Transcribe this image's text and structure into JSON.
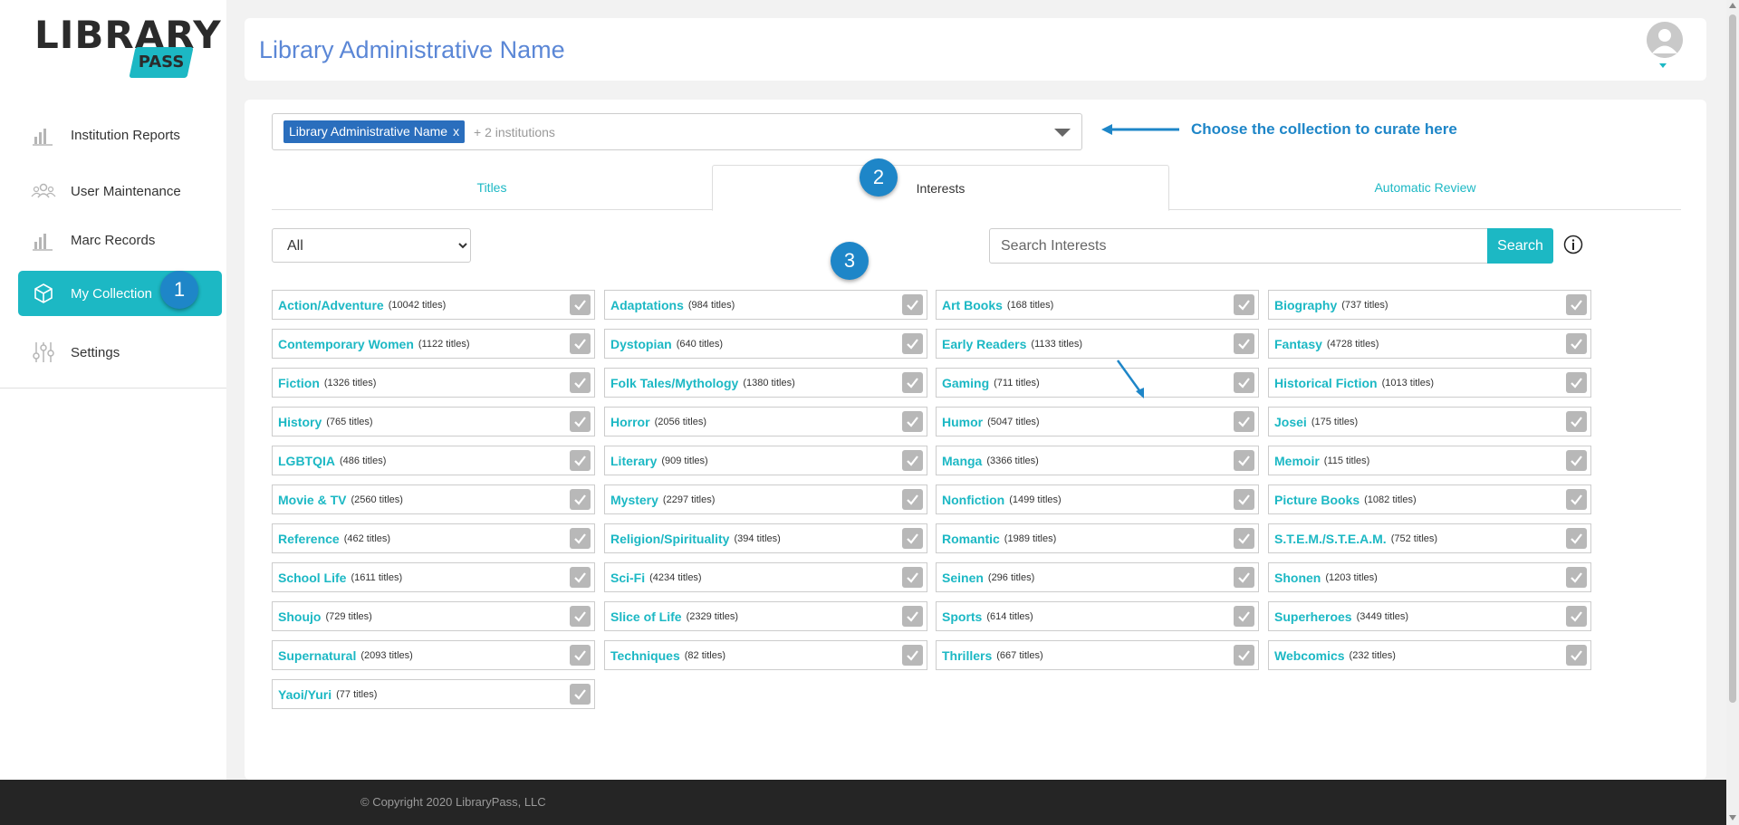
{
  "brand": {
    "logo_top": "LIBRARY",
    "logo_sub": "PASS"
  },
  "sidebar": {
    "items": [
      {
        "label": "Institution Reports",
        "icon": "bar-chart-icon"
      },
      {
        "label": "User Maintenance",
        "icon": "users-icon"
      },
      {
        "label": "Marc Records",
        "icon": "bar-chart-icon"
      },
      {
        "label": "My Collection",
        "icon": "box-icon",
        "active": true
      },
      {
        "label": "Settings",
        "icon": "sliders-icon"
      }
    ]
  },
  "header": {
    "title": "Library Administrative Name"
  },
  "collection_select": {
    "chip_label": "Library Administrative Name",
    "chip_remove": "x",
    "more": "+ 2 institutions",
    "hint": "Choose the collection to curate here"
  },
  "tabs": [
    {
      "label": "Titles"
    },
    {
      "label": "Interests",
      "active": true
    },
    {
      "label": "Automatic Review"
    }
  ],
  "filter": {
    "selected": "All"
  },
  "search": {
    "placeholder": "Search Interests",
    "button": "Search"
  },
  "annotations": {
    "one": "1",
    "two": "2",
    "three": "3"
  },
  "interests": [
    {
      "name": "Action/Adventure",
      "count": "(10042 titles)"
    },
    {
      "name": "Adaptations",
      "count": "(984 titles)"
    },
    {
      "name": "Art Books",
      "count": "(168 titles)"
    },
    {
      "name": "Biography",
      "count": "(737 titles)"
    },
    {
      "name": "Contemporary Women",
      "count": "(1122 titles)"
    },
    {
      "name": "Dystopian",
      "count": "(640 titles)"
    },
    {
      "name": "Early Readers",
      "count": "(1133 titles)"
    },
    {
      "name": "Fantasy",
      "count": "(4728 titles)"
    },
    {
      "name": "Fiction",
      "count": "(1326 titles)"
    },
    {
      "name": "Folk Tales/Mythology",
      "count": "(1380 titles)"
    },
    {
      "name": "Gaming",
      "count": "(711 titles)"
    },
    {
      "name": "Historical Fiction",
      "count": "(1013 titles)"
    },
    {
      "name": "History",
      "count": "(765 titles)"
    },
    {
      "name": "Horror",
      "count": "(2056 titles)"
    },
    {
      "name": "Humor",
      "count": "(5047 titles)"
    },
    {
      "name": "Josei",
      "count": "(175 titles)"
    },
    {
      "name": "LGBTQIA",
      "count": "(486 titles)"
    },
    {
      "name": "Literary",
      "count": "(909 titles)"
    },
    {
      "name": "Manga",
      "count": "(3366 titles)"
    },
    {
      "name": "Memoir",
      "count": "(115 titles)"
    },
    {
      "name": "Movie & TV",
      "count": "(2560 titles)"
    },
    {
      "name": "Mystery",
      "count": "(2297 titles)"
    },
    {
      "name": "Nonfiction",
      "count": "(1499 titles)"
    },
    {
      "name": "Picture Books",
      "count": "(1082 titles)"
    },
    {
      "name": "Reference",
      "count": "(462 titles)"
    },
    {
      "name": "Religion/Spirituality",
      "count": "(394 titles)"
    },
    {
      "name": "Romantic",
      "count": "(1989 titles)"
    },
    {
      "name": "S.T.E.M./S.T.E.A.M.",
      "count": "(752 titles)"
    },
    {
      "name": "School Life",
      "count": "(1611 titles)"
    },
    {
      "name": "Sci-Fi",
      "count": "(4234 titles)"
    },
    {
      "name": "Seinen",
      "count": "(296 titles)"
    },
    {
      "name": "Shonen",
      "count": "(1203 titles)"
    },
    {
      "name": "Shoujo",
      "count": "(729 titles)"
    },
    {
      "name": "Slice of Life",
      "count": "(2329 titles)"
    },
    {
      "name": "Sports",
      "count": "(614 titles)"
    },
    {
      "name": "Superheroes",
      "count": "(3449 titles)"
    },
    {
      "name": "Supernatural",
      "count": "(2093 titles)"
    },
    {
      "name": "Techniques",
      "count": "(82 titles)"
    },
    {
      "name": "Thrillers",
      "count": "(667 titles)"
    },
    {
      "name": "Webcomics",
      "count": "(232 titles)"
    },
    {
      "name": "Yaoi/Yuri",
      "count": "(77 titles)"
    }
  ],
  "footer": {
    "copyright": "© Copyright 2020 LibraryPass, LLC"
  },
  "colors": {
    "accent": "#1cb8c4",
    "title": "#5b87d6",
    "annotation": "#1e86c8"
  }
}
